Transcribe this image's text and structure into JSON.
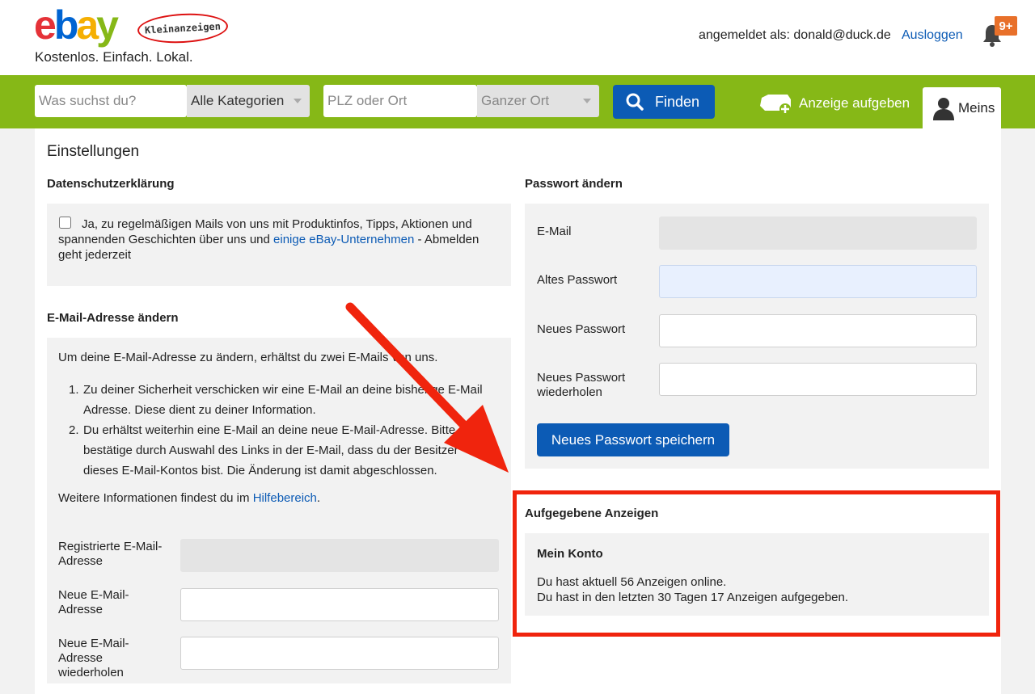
{
  "header": {
    "logo_letters": [
      "e",
      "b",
      "a",
      "y"
    ],
    "badge": "Kleinanzeigen",
    "tagline": "Kostenlos. Einfach. Lokal.",
    "login_info": "angemeldet als: donald@duck.de",
    "logout": "Ausloggen",
    "notification_count": "9+"
  },
  "search": {
    "query_placeholder": "Was suchst du?",
    "category": "Alle Kategorien",
    "location_placeholder": "PLZ oder Ort",
    "radius": "Ganzer Ort",
    "find_label": "Finden",
    "post_ad_label": "Anzeige aufgeben",
    "account_label": "Meins"
  },
  "page": {
    "title": "Einstellungen"
  },
  "privacy": {
    "title": "Datenschutzerklärung",
    "text_before": "Ja, zu regelmäßigen Mails von uns mit Produktinfos, Tipps, Aktionen und spannenden Geschichten über uns und ",
    "link": "einige eBay-Unternehmen",
    "text_after": " - Abmelden geht jederzeit",
    "checked": false
  },
  "email_change": {
    "title": "E-Mail-Adresse ändern",
    "intro": "Um deine E-Mail-Adresse zu ändern, erhältst du zwei E-Mails von uns.",
    "steps": [
      "Zu deiner Sicherheit verschicken wir eine E-Mail an deine bisherige E-Mail Adresse. Diese dient zu deiner Information.",
      "Du erhältst weiterhin eine E-Mail an deine neue E-Mail-Adresse. Bitte bestätige durch Auswahl des Links in der E-Mail, dass du der Besitzer dieses E-Mail-Kontos bist. Die Änderung ist damit abgeschlossen."
    ],
    "info_text": "Weitere Informationen findest du im ",
    "info_link": "Hilfebereich",
    "info_end": ".",
    "registered_label": "Registrierte E-Mail-Adresse",
    "new_label": "Neue E-Mail-Adresse",
    "repeat_label": "Neue E-Mail-Adresse wiederholen"
  },
  "password": {
    "title": "Passwort ändern",
    "email_label": "E-Mail",
    "old_label": "Altes Passwort",
    "new_label": "Neues Passwort",
    "repeat_label": "Neues Passwort wiederholen",
    "save_label": "Neues Passwort speichern"
  },
  "ads": {
    "title": "Aufgegebene Anzeigen",
    "box_title": "Mein Konto",
    "line1": "Du hast aktuell 56 Anzeigen online.",
    "line2": "Du hast in den letzten 30 Tagen 17 Anzeigen aufgegeben."
  },
  "colors": {
    "brand_green": "#86b817",
    "link_blue": "#0c5bb5",
    "highlight_red": "#f0240d",
    "badge_orange": "#e8702a"
  }
}
